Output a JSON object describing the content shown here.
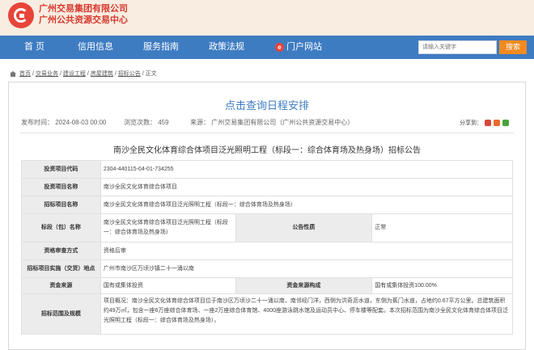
{
  "header": {
    "org_line1": "广州交易集团有限公司",
    "org_line2": "广州公共资源交易中心",
    "logo_color": "#e8443a"
  },
  "nav": {
    "items": [
      "首 页",
      "信用信息",
      "服务指南",
      "政策法规",
      "门户网站"
    ],
    "portal_badge": "e",
    "search_placeholder": "请输入关键字",
    "search_button": "搜索",
    "bar_color": "#3e7cc2",
    "search_color": "#f28a1f"
  },
  "breadcrumb": {
    "items": [
      "首页",
      "交易业务",
      "建设工程",
      "房屋建筑",
      "招标公告",
      "正文"
    ],
    "separator": "/"
  },
  "article": {
    "title": "点击查询日程安排",
    "publish_time": "发布时间：  2024-08-03 00:00",
    "views": "浏览次数：  459",
    "source": "来源：  广州交易集团有限公司（广州公共资源交易中心）",
    "share_label": "分享到：",
    "notice_title": "南沙全民文化体育综合体项目泛光照明工程（标段一：综合体育场及热身场）招标公告"
  },
  "table": {
    "rows": {
      "code": {
        "label": "投资项目代码",
        "value": "2304-440115-04-01-734255"
      },
      "project_name": {
        "label": "投资项目名称",
        "value": "南沙全民文化体育综合体项目"
      },
      "tender_project": {
        "label": "招标项目名称",
        "value": "南沙全民文化体育综合体项目泛光照明工程（标段一：综合体育场及热身场）"
      },
      "section": {
        "label": "标段（包）名称",
        "value": "南沙全民文化体育综合体项目泛光照明工程（标段一：综合体育场及热身场）",
        "label2": "公告性质",
        "value2": "正常"
      },
      "qualification": {
        "label": "资格审查方式",
        "value": "资格后审"
      },
      "location": {
        "label": "招标项目实施（交货）地点",
        "value": "广州市南沙区万顷沙镇二十一涌以南"
      },
      "funding": {
        "label": "资金来源",
        "value": "国有或集体投资",
        "label2": "资金来源构成",
        "value2": "国有或集体投资100.00%"
      },
      "scope": {
        "label": "招标范围及规模",
        "value": "项目概况：南沙全民文化体育综合体项目位于南沙区万顷沙二十一涌以南，南邻经门洋，西侧为洪奇沥水道，东侧为蕉门水道，占地约0.67平方公里。总建筑面积约49万㎡，包含一座6万座综合体育场、一座2万座综合体育馆、4000座游泳跳水馆及运动员中心、停车楼等配套。本次招标范围为南沙全民文化体育综合体项目泛光照明工程（标段一：综合体育场及热身场）。"
      }
    }
  }
}
